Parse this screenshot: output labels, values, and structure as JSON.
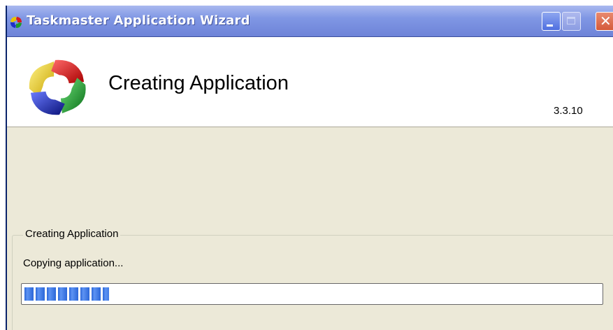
{
  "window": {
    "title": "Taskmaster Application Wizard"
  },
  "titlebar_buttons": {
    "minimize_icon": "minimize-icon",
    "maximize_icon": "maximize-icon",
    "close_icon": "close-icon",
    "close_glyph": "✕"
  },
  "header": {
    "title": "Creating Application",
    "version": "3.3.10",
    "logo_icon": "taskmaster-logo-icon"
  },
  "group": {
    "legend": "Creating Application",
    "status": "Copying application...",
    "progress_fraction": 0.147
  },
  "colors": {
    "titlebar": "#8097e4",
    "progress": "#2c67d8",
    "close_button": "#d45a3a",
    "background": "#ece9d8"
  }
}
